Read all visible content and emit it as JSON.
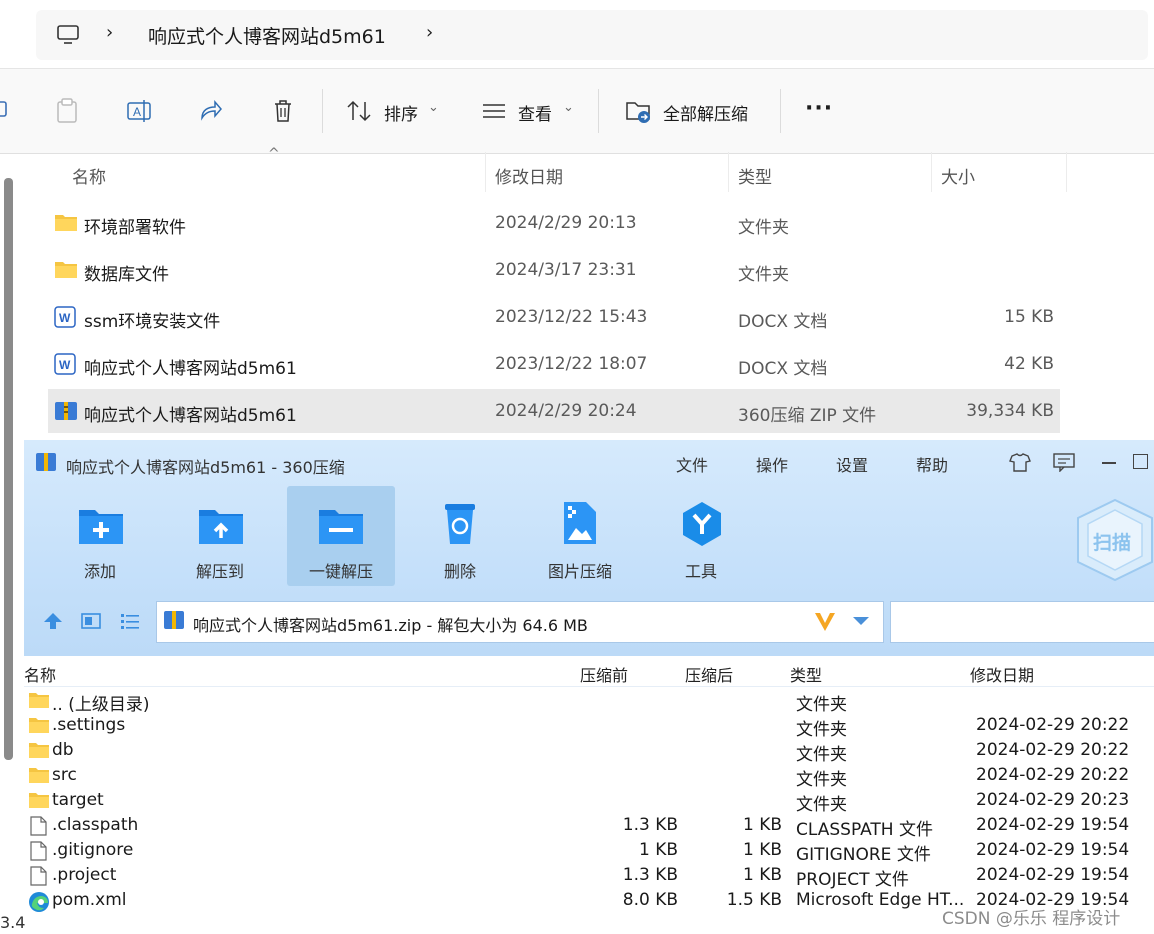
{
  "explorer": {
    "breadcrumb": {
      "path": "响应式个人博客网站d5m61"
    },
    "toolbar": {
      "sort": "排序",
      "view": "查看",
      "extract_all": "全部解压缩"
    },
    "columns": {
      "name": "名称",
      "modified": "修改日期",
      "type": "类型",
      "size": "大小"
    },
    "files": [
      {
        "name": "环境部署软件",
        "modified": "2024/2/29 20:13",
        "type": "文件夹",
        "size": "",
        "icon": "folder-icon"
      },
      {
        "name": "数据库文件",
        "modified": "2024/3/17 23:31",
        "type": "文件夹",
        "size": "",
        "icon": "folder-icon"
      },
      {
        "name": "ssm环境安装文件",
        "modified": "2023/12/22 15:43",
        "type": "DOCX 文档",
        "size": "15 KB",
        "icon": "docx-icon"
      },
      {
        "name": "响应式个人博客网站d5m61",
        "modified": "2023/12/22 18:07",
        "type": "DOCX 文档",
        "size": "42 KB",
        "icon": "docx-icon"
      },
      {
        "name": "响应式个人博客网站d5m61",
        "modified": "2024/2/29 20:24",
        "type": "360压缩 ZIP 文件",
        "size": "39,334 KB",
        "icon": "zip-icon",
        "selected": true
      }
    ]
  },
  "zip_window": {
    "title": "响应式个人博客网站d5m61 - 360压缩",
    "menu": [
      "文件",
      "操作",
      "设置",
      "帮助"
    ],
    "toolbar": [
      "添加",
      "解压到",
      "一键解压",
      "删除",
      "图片压缩",
      "工具"
    ],
    "scan_label": "扫描",
    "path": "响应式个人博客网站d5m61.zip - 解包大小为 64.6 MB",
    "columns": {
      "name": "名称",
      "before": "压缩前",
      "after": "压缩后",
      "type": "类型",
      "modified": "修改日期"
    },
    "entries": [
      {
        "name": ".. (上级目录)",
        "before": "",
        "after": "",
        "type": "文件夹",
        "modified": "",
        "icon": "folder-icon"
      },
      {
        "name": ".settings",
        "before": "",
        "after": "",
        "type": "文件夹",
        "modified": "2024-02-29 20:22",
        "icon": "folder-icon"
      },
      {
        "name": "db",
        "before": "",
        "after": "",
        "type": "文件夹",
        "modified": "2024-02-29 20:22",
        "icon": "folder-icon"
      },
      {
        "name": "src",
        "before": "",
        "after": "",
        "type": "文件夹",
        "modified": "2024-02-29 20:22",
        "icon": "folder-icon"
      },
      {
        "name": "target",
        "before": "",
        "after": "",
        "type": "文件夹",
        "modified": "2024-02-29 20:23",
        "icon": "folder-icon"
      },
      {
        "name": ".classpath",
        "before": "1.3 KB",
        "after": "1 KB",
        "type": "CLASSPATH 文件",
        "modified": "2024-02-29 19:54",
        "icon": "file-icon"
      },
      {
        "name": ".gitignore",
        "before": "1 KB",
        "after": "1 KB",
        "type": "GITIGNORE 文件",
        "modified": "2024-02-29 19:54",
        "icon": "file-icon"
      },
      {
        "name": ".project",
        "before": "1.3 KB",
        "after": "1 KB",
        "type": "PROJECT 文件",
        "modified": "2024-02-29 19:54",
        "icon": "file-icon"
      },
      {
        "name": "pom.xml",
        "before": "8.0 KB",
        "after": "1.5 KB",
        "type": "Microsoft Edge HT...",
        "modified": "2024-02-29 19:54",
        "icon": "edge-icon"
      }
    ]
  },
  "watermark": "CSDN @乐乐 程序设计",
  "edge_fragment": "3.4"
}
